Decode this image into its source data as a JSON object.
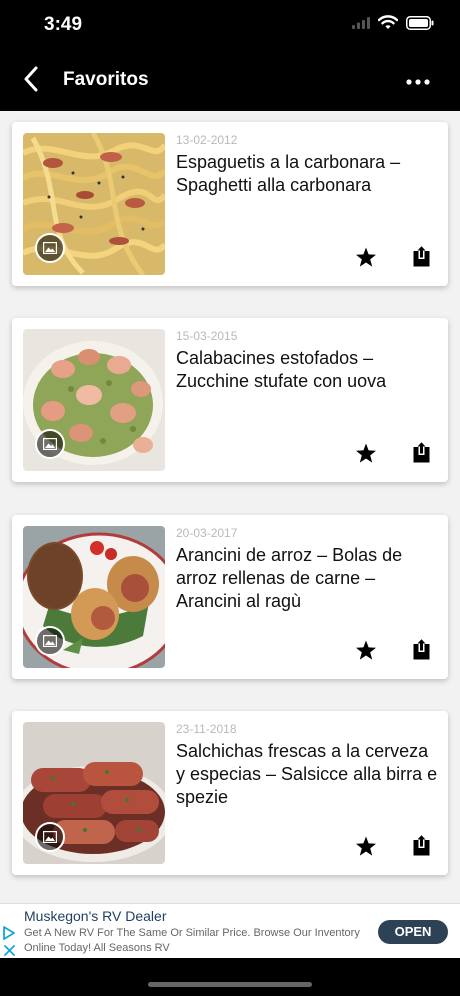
{
  "status_bar": {
    "time": "3:49"
  },
  "nav": {
    "title": "Favoritos",
    "back_icon": "chevron-left-icon",
    "more_icon": "ellipsis-icon"
  },
  "recipes": [
    {
      "date": "13-02-2012",
      "title": "Espaguetis a la carbonara – Spaghetti alla carbonara"
    },
    {
      "date": "15-03-2015",
      "title": "Calabacines estofados – Zucchine stufate con uova"
    },
    {
      "date": "20-03-2017",
      "title": "Arancini de arroz – Bolas de arroz rellenas de carne – Arancini al ragù"
    },
    {
      "date": "23-11-2018",
      "title": "Salchichas frescas a la cerveza y especias – Salsicce alla birra e spezie"
    }
  ],
  "ad": {
    "title": "Muskegon's RV Dealer",
    "description": "Get A New RV For The Same Or Similar Price. Browse Our Inventory Online Today!",
    "advertiser": "All Seasons RV",
    "cta": "OPEN"
  },
  "colors": {
    "nav_background": "#000000",
    "list_background": "#f2f2f2",
    "ad_button": "#2e4255"
  }
}
